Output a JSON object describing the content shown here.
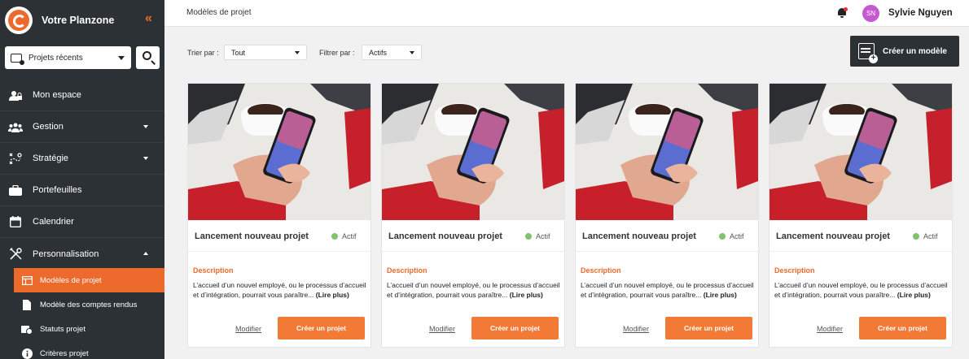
{
  "brand": {
    "name": "Votre Planzone",
    "collapse_icon": "double-chevron-left-icon",
    "accent": "#ec6a2c"
  },
  "recent": {
    "value": "Projets récents"
  },
  "nav": {
    "items": [
      {
        "label": "Mon espace",
        "icon": "user-lock-icon"
      },
      {
        "label": "Gestion",
        "icon": "team-icon"
      },
      {
        "label": "Stratégie",
        "icon": "strategy-icon"
      },
      {
        "label": "Portefeuilles",
        "icon": "briefcase-icon"
      },
      {
        "label": "Calendrier",
        "icon": "calendar-icon"
      },
      {
        "label": "Personnalisation",
        "icon": "tools-icon"
      }
    ],
    "subitems": [
      {
        "label": "Modèles de projet",
        "icon": "template-icon"
      },
      {
        "label": "Modèle des comptes rendus",
        "icon": "document-icon"
      },
      {
        "label": "Statuts projet",
        "icon": "status-icon"
      },
      {
        "label": "Critères projet",
        "icon": "info-icon"
      }
    ]
  },
  "topbar": {
    "breadcrumb": "Modèles de projet",
    "user_name": "Sylvie Nguyen",
    "user_initials": "SN"
  },
  "filters": {
    "sort_label": "Trier par :",
    "sort_value": "Tout",
    "filter_label": "Filtrer par :",
    "filter_value": "Actifs"
  },
  "create_model_label": "Créer un modèle",
  "cards": [
    {
      "title": "Lancement nouveau projet",
      "status": "Actif",
      "desc_label": "Description",
      "desc": "L’accueil d’un nouvel employé, ou le processus d’accueil et d’intégration, pourrait vous paraître...",
      "more": "(Lire plus)",
      "modify": "Modifier",
      "create": "Créer un projet"
    },
    {
      "title": "Lancement nouveau projet",
      "status": "Actif",
      "desc_label": "Description",
      "desc": "L’accueil d’un nouvel employé, ou le processus d’accueil et d’intégration, pourrait vous paraître...",
      "more": "(Lire plus)",
      "modify": "Modifier",
      "create": "Créer un projet"
    },
    {
      "title": "Lancement nouveau projet",
      "status": "Actif",
      "desc_label": "Description",
      "desc": "L’accueil d’un nouvel employé, ou le processus d’accueil et d’intégration, pourrait vous paraître...",
      "more": "(Lire plus)",
      "modify": "Modifier",
      "create": "Créer un projet"
    },
    {
      "title": "Lancement nouveau projet",
      "status": "Actif",
      "desc_label": "Description",
      "desc": "L’accueil d’un nouvel employé, ou le processus d’accueil et d’intégration, pourrait vous paraître...",
      "more": "(Lire plus)",
      "modify": "Modifier",
      "create": "Créer un projet"
    }
  ],
  "colors": {
    "sidebar": "#2b3134",
    "active_status": "#7fc36e",
    "button": "#f27a36",
    "avatar": "#c45ad0"
  }
}
